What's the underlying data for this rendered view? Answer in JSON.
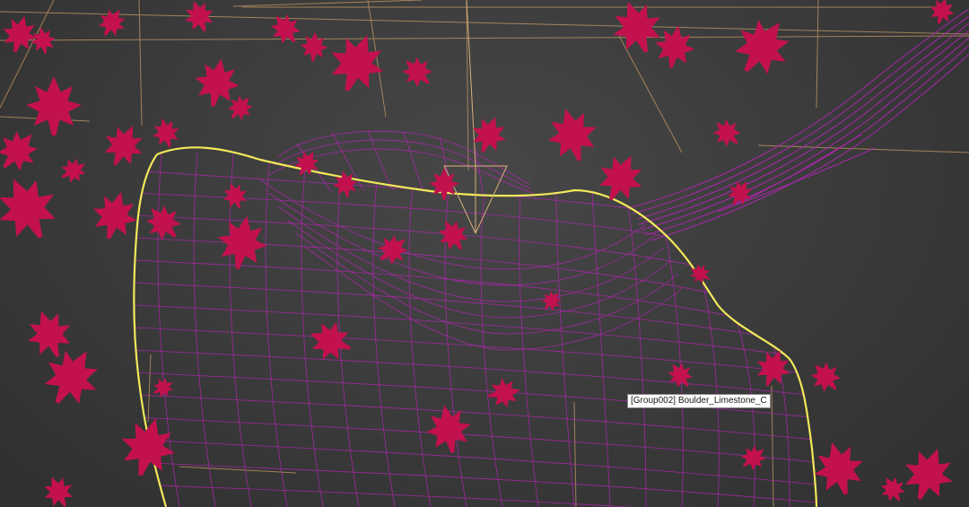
{
  "viewport": {
    "hover_tooltip": "[Group002] Boulder_Limestone_C"
  },
  "scene": {
    "background_color": "#3d3d3d",
    "wireframe_color": "#b325b3",
    "selection_outline_color": "#f2e85a",
    "bounding_box_color": "#c89a66",
    "leaf_color": "#c2114e",
    "icons": [
      "maple-leaf-icon",
      "camera-target-icon"
    ]
  }
}
